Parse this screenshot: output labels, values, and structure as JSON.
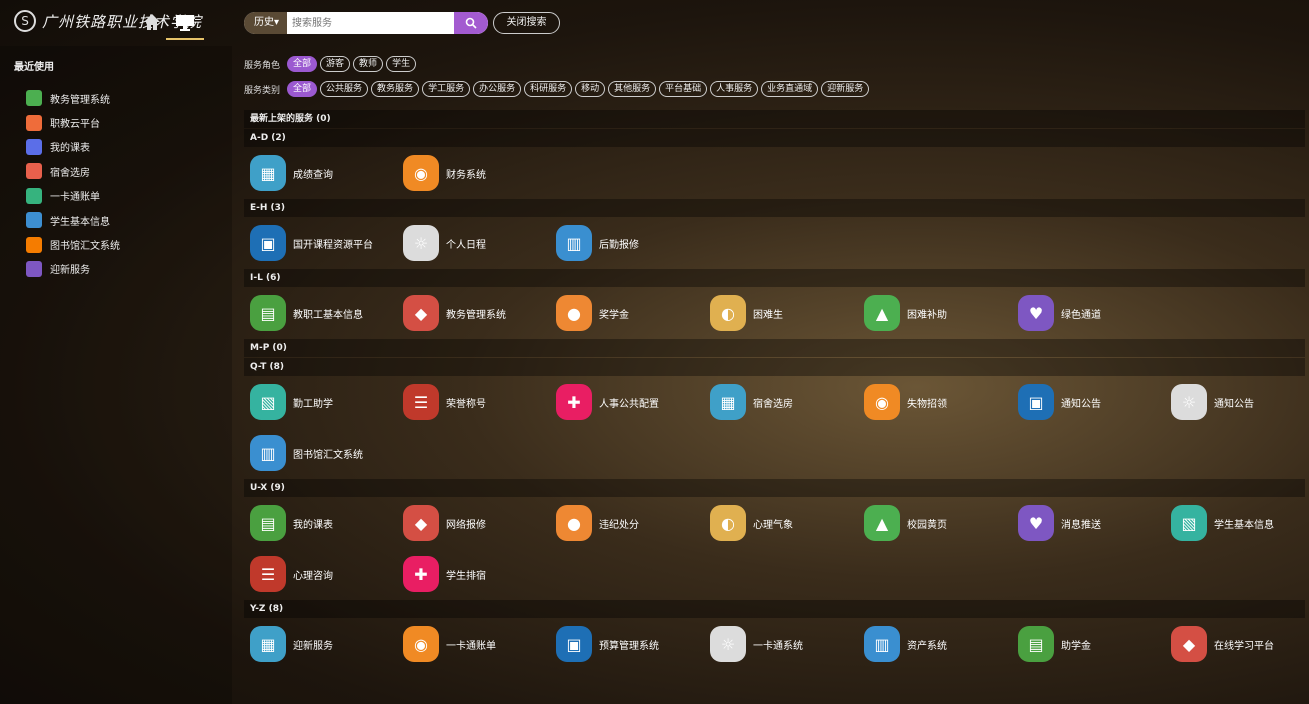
{
  "header": {
    "logo_text": "广州铁路职业技术学院",
    "history_label": "历史▾",
    "search_placeholder": "搜索服务",
    "close_search_label": "关闭搜索"
  },
  "sidebar": {
    "title": "最近使用",
    "items": [
      {
        "label": "教务管理系统",
        "color": "#4caf50"
      },
      {
        "label": "职教云平台",
        "color": "#ef6c3a"
      },
      {
        "label": "我的课表",
        "color": "#5b6ee8"
      },
      {
        "label": "宿舍选房",
        "color": "#e8604c"
      },
      {
        "label": "一卡通账单",
        "color": "#36b37e"
      },
      {
        "label": "学生基本信息",
        "color": "#3d8fd1"
      },
      {
        "label": "图书馆汇文系统",
        "color": "#f57c00"
      },
      {
        "label": "迎新服务",
        "color": "#7e57c2"
      }
    ]
  },
  "filters": {
    "role_label": "服务角色",
    "roles": [
      "全部",
      "游客",
      "教师",
      "学生"
    ],
    "category_label": "服务类别",
    "categories": [
      "全部",
      "公共服务",
      "教务服务",
      "学工服务",
      "办公服务",
      "科研服务",
      "移动",
      "其他服务",
      "平台基础",
      "人事服务",
      "业务直通域",
      "迎新服务"
    ]
  },
  "sections": {
    "newest": "最新上架的服务 (0)",
    "ad": "A-D (2)",
    "eh": "E-H (3)",
    "il": "I-L (6)",
    "mp": "M-P (0)",
    "qt": "Q-T (8)",
    "ux": "U-X (9)",
    "yz": "Y-Z (8)"
  },
  "apps": {
    "ad": [
      "成绩查询",
      "财务系统"
    ],
    "eh": [
      "国开课程资源平台",
      "个人日程",
      "后勤报修"
    ],
    "il": [
      "教职工基本信息",
      "教务管理系统",
      "奖学金",
      "困难生",
      "困难补助",
      "绿色通道"
    ],
    "qt1": [
      "勤工助学",
      "荣誉称号",
      "人事公共配置",
      "宿舍选房",
      "失物招领",
      "通知公告",
      "通知公告"
    ],
    "qt2": [
      "图书馆汇文系统"
    ],
    "ux1": [
      "我的课表",
      "网络报修",
      "违纪处分",
      "心理气象",
      "校园黄页",
      "消息推送",
      "学生基本信息"
    ],
    "ux2": [
      "心理咨询",
      "学生排宿"
    ],
    "yz": [
      "迎新服务",
      "一卡通账单",
      "预算管理系统",
      "一卡通系统",
      "资产系统",
      "助学金",
      "在线学习平台"
    ]
  }
}
